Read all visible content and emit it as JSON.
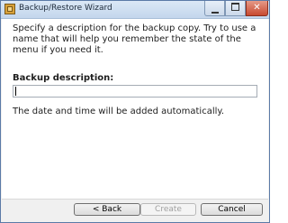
{
  "window": {
    "title": "Backup/Restore Wizard",
    "minimize_label": "",
    "maximize_label": "",
    "close_label": "✕"
  },
  "content": {
    "description": "Specify a description for the backup copy. Try to use a name that will help you remember the state of the menu if you need it.",
    "field_label": "Backup description:",
    "field_value": "",
    "note": "The date and time will be added automatically."
  },
  "buttons": {
    "back": "< Back",
    "create": "Create",
    "cancel": "Cancel"
  },
  "icons": {
    "app": "wizard-app-icon"
  }
}
